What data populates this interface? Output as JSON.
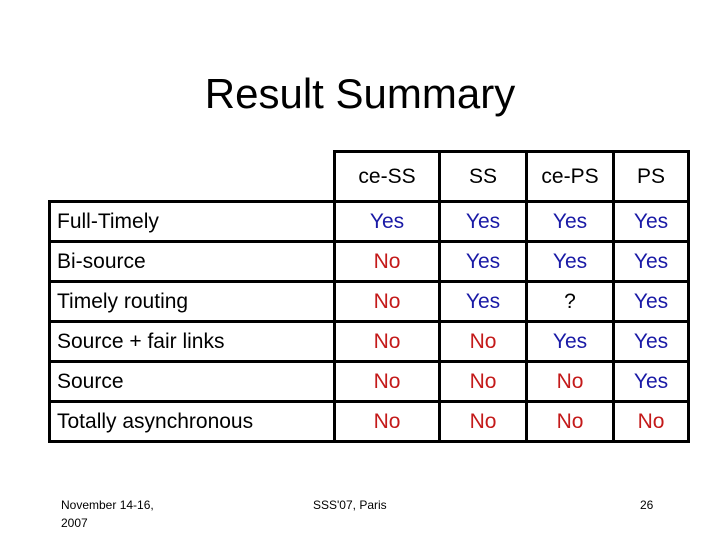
{
  "slide": {
    "title": "Result Summary",
    "colors": {
      "yes": "#1a1aa6",
      "no": "#c41a1a",
      "text": "#000000",
      "background": "#ffffff"
    }
  },
  "table": {
    "columns": [
      "ce-SS",
      "SS",
      "ce-PS",
      "PS"
    ],
    "rows": [
      {
        "label": "Full-Timely",
        "cells": [
          {
            "value": "Yes",
            "bold": true
          },
          {
            "value": "Yes",
            "bold": false
          },
          {
            "value": "Yes",
            "bold": false
          },
          {
            "value": "Yes",
            "bold": false
          }
        ]
      },
      {
        "label": "Bi-source",
        "cells": [
          {
            "value": "No",
            "bold": false
          },
          {
            "value": "Yes",
            "bold": true
          },
          {
            "value": "Yes",
            "bold": true
          },
          {
            "value": "Yes",
            "bold": false
          }
        ]
      },
      {
        "label": "Timely routing",
        "cells": [
          {
            "value": "No",
            "bold": false
          },
          {
            "value": "Yes",
            "bold": true
          },
          {
            "value": "?",
            "bold": false
          },
          {
            "value": "Yes",
            "bold": false
          }
        ]
      },
      {
        "label": "Source + fair links",
        "cells": [
          {
            "value": "No",
            "bold": false
          },
          {
            "value": "No",
            "bold": false
          },
          {
            "value": "Yes",
            "bold": true
          },
          {
            "value": "Yes",
            "bold": false
          }
        ]
      },
      {
        "label": "Source",
        "cells": [
          {
            "value": "No",
            "bold": false
          },
          {
            "value": "No",
            "bold": false
          },
          {
            "value": "No",
            "bold": false
          },
          {
            "value": "Yes",
            "bold": true
          }
        ]
      },
      {
        "label": "Totally asynchronous",
        "cells": [
          {
            "value": "No",
            "bold": false
          },
          {
            "value": "No",
            "bold": false
          },
          {
            "value": "No",
            "bold": false
          },
          {
            "value": "No",
            "bold": false
          }
        ]
      }
    ]
  },
  "footer": {
    "date_line1": "November 14-16,",
    "date_line2": "2007",
    "venue": "SSS'07, Paris",
    "page_number": "26"
  }
}
